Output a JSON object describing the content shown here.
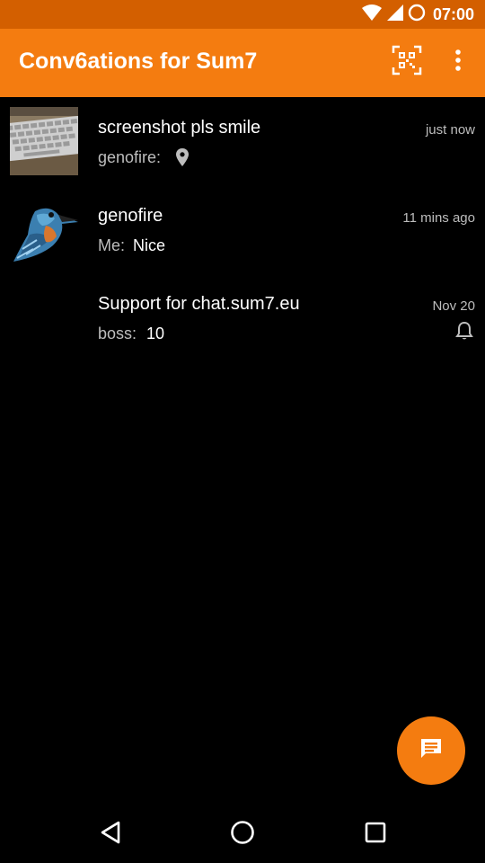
{
  "status_bar": {
    "time": "07:00",
    "icons": [
      "wifi-icon",
      "signal-icon",
      "battery-icon"
    ]
  },
  "app_bar": {
    "title": "Conv6ations for Sum7",
    "actions": [
      "qr-code-icon",
      "overflow-menu-icon"
    ]
  },
  "conversations": [
    {
      "name": "screenshot pls smile",
      "time": "just now",
      "sender": "genofire:",
      "preview": "",
      "preview_icon": "location-pin-icon",
      "avatar": "keyboard-photo"
    },
    {
      "name": "genofire",
      "time": "11 mins ago",
      "sender": "Me:",
      "preview": "Nice",
      "avatar": "kingfisher-drawing"
    },
    {
      "name": "Support for chat.sum7.eu",
      "time": "Nov 20",
      "sender": "boss:",
      "preview": "10",
      "status_icon": "notification-bell-icon"
    }
  ],
  "fab": {
    "icon": "new-message-icon"
  },
  "nav_bar": {
    "icons": [
      "back-icon",
      "home-icon",
      "recents-icon"
    ]
  },
  "colors": {
    "primary": "#f47c10",
    "status_bar": "#d35f00",
    "background": "#000000",
    "secondary_text": "#bdbdbd"
  }
}
